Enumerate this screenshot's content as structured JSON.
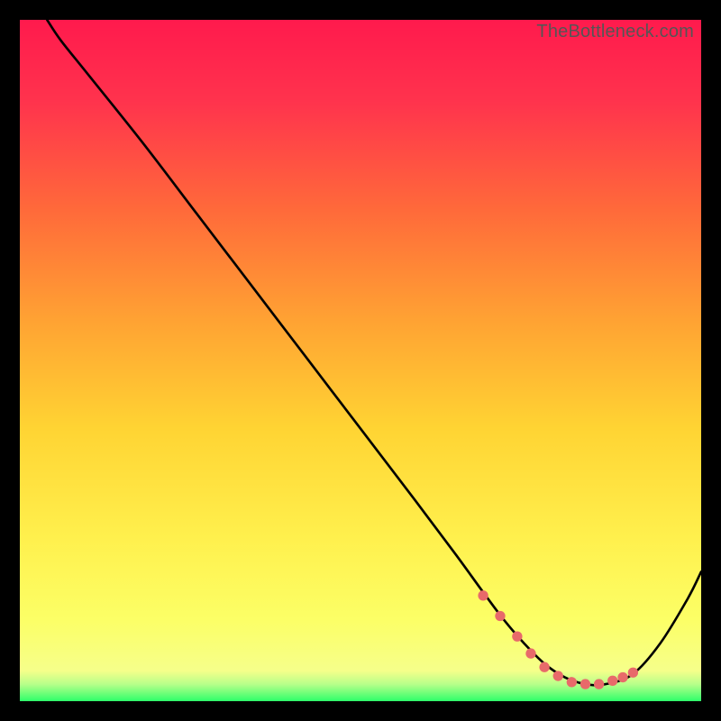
{
  "watermark": "TheBottleneck.com",
  "gradient_stops": [
    {
      "offset": 0.0,
      "color": "#ff1a4d"
    },
    {
      "offset": 0.12,
      "color": "#ff334d"
    },
    {
      "offset": 0.28,
      "color": "#ff6a3a"
    },
    {
      "offset": 0.44,
      "color": "#ffa233"
    },
    {
      "offset": 0.6,
      "color": "#ffd433"
    },
    {
      "offset": 0.76,
      "color": "#fff04d"
    },
    {
      "offset": 0.88,
      "color": "#fcff66"
    },
    {
      "offset": 0.955,
      "color": "#f6ff8a"
    },
    {
      "offset": 0.975,
      "color": "#b8ff8a"
    },
    {
      "offset": 1.0,
      "color": "#2eff6a"
    }
  ],
  "chart_data": {
    "type": "line",
    "title": "",
    "xlabel": "",
    "ylabel": "",
    "xlim": [
      0,
      100
    ],
    "ylim": [
      0,
      100
    ],
    "series": [
      {
        "name": "bottleneck-curve",
        "x": [
          4,
          6,
          10,
          18,
          26,
          34,
          42,
          50,
          58,
          64,
          68,
          71,
          74,
          77,
          80,
          83,
          86,
          90,
          94,
          98,
          100
        ],
        "y": [
          100,
          97,
          92,
          82,
          71.5,
          61,
          50.5,
          40,
          29.5,
          21.5,
          16,
          12,
          8.5,
          5.5,
          3.5,
          2.5,
          2.5,
          4,
          8.5,
          15,
          19
        ]
      }
    ],
    "markers": {
      "name": "highlight-dots",
      "color": "#e86a6a",
      "x": [
        68,
        70.5,
        73,
        75,
        77,
        79,
        81,
        83,
        85,
        87,
        88.5,
        90
      ],
      "y": [
        15.5,
        12.5,
        9.5,
        7,
        5,
        3.7,
        2.8,
        2.5,
        2.5,
        3,
        3.5,
        4.2
      ]
    }
  }
}
